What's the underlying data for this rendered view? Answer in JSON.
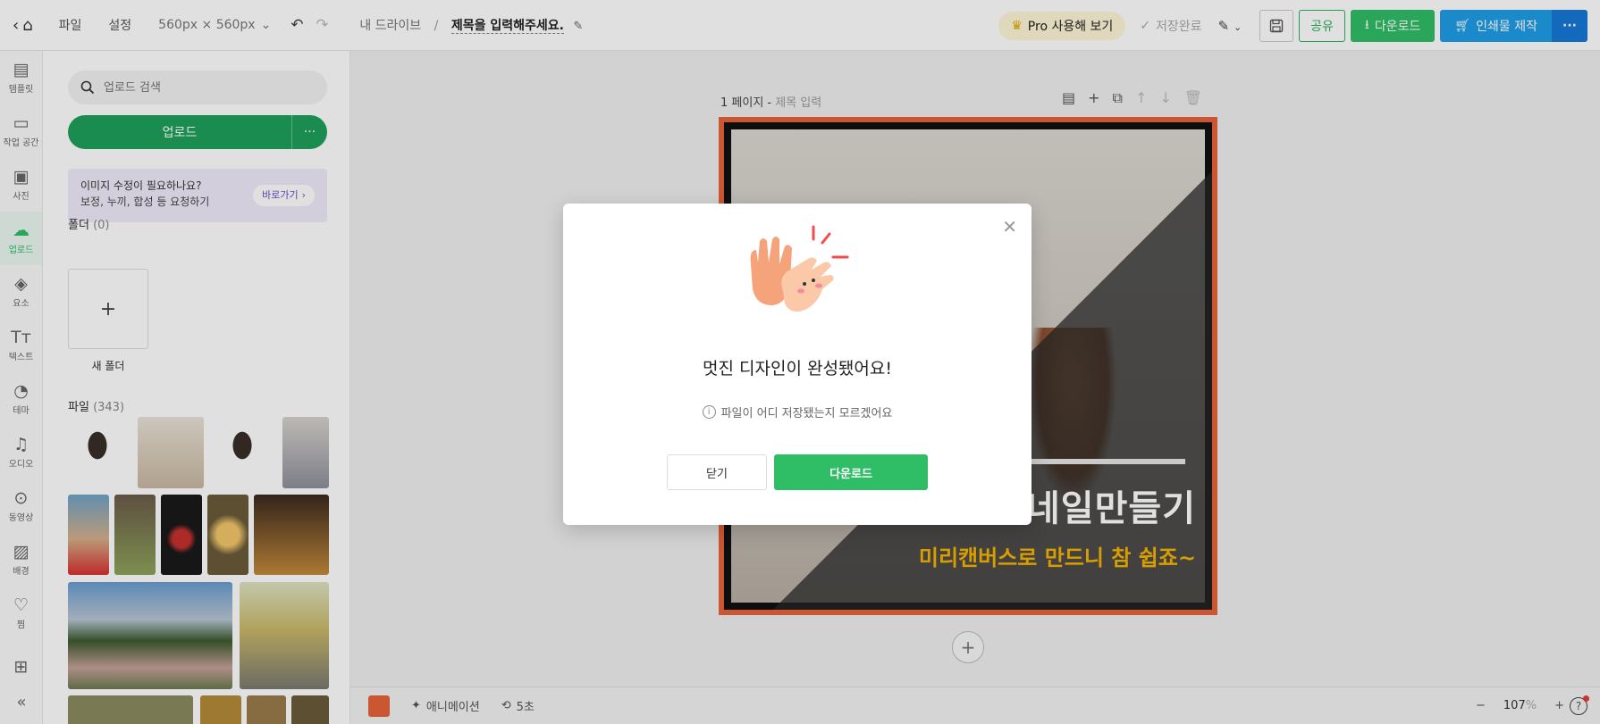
{
  "topbar": {
    "home_icon": "home-icon",
    "menu_file": "파일",
    "menu_settings": "설정",
    "canvas_size": "560px × 560px",
    "breadcrumb_drive": "내 드라이브",
    "breadcrumb_sep": "/",
    "doc_title": "제목을 입력해주세요.",
    "pro_label": "Pro 사용해 보기",
    "saved_label": "저장완료",
    "share_label": "공유",
    "download_label": "다운로드",
    "print_label": "인쇄물 제작",
    "more_label": "···"
  },
  "rail": {
    "items": [
      {
        "label": "템플릿",
        "icon": "template-icon"
      },
      {
        "label": "작업 공간",
        "icon": "workspace-icon"
      },
      {
        "label": "사진",
        "icon": "photo-icon"
      },
      {
        "label": "업로드",
        "icon": "upload-cloud-icon",
        "active": true
      },
      {
        "label": "요소",
        "icon": "elements-icon"
      },
      {
        "label": "텍스트",
        "icon": "text-icon"
      },
      {
        "label": "테마",
        "icon": "palette-icon"
      },
      {
        "label": "오디오",
        "icon": "music-icon"
      },
      {
        "label": "동영상",
        "icon": "play-icon"
      },
      {
        "label": "배경",
        "icon": "background-icon"
      },
      {
        "label": "찜",
        "icon": "heart-icon"
      },
      {
        "label": "",
        "icon": "grid-icon"
      }
    ],
    "collapse_icon": "double-chevron-left-icon"
  },
  "panel": {
    "search_placeholder": "업로드 검색",
    "upload_label": "업로드",
    "upload_more": "···",
    "promo_line1": "이미지 수정이 필요하나요?",
    "promo_line2": "보정, 누끼, 합성 등 요청하기",
    "promo_button": "바로가기",
    "folder_title": "폴더",
    "folder_count": "(0)",
    "new_folder_plus": "+",
    "new_folder_label": "새 폴더",
    "files_title": "파일",
    "files_count": "(343)"
  },
  "canvas": {
    "page_label": "1 페이지 -",
    "page_title_placeholder": "제목 입력",
    "headline": "네일만들기",
    "subheadline": "미리캔버스로 만드니 참 쉽죠~",
    "add_page": "+"
  },
  "bottombar": {
    "color_hex": "#e8643a",
    "animation_label": "애니메이션",
    "timer_label": "5초",
    "zoom_minus": "−",
    "zoom_value": "107",
    "zoom_unit": "%",
    "zoom_plus": "+",
    "help_label": "?"
  },
  "modal": {
    "close_icon": "close-icon",
    "title": "멋진 디자인이 완성됐어요!",
    "help_text": "파일이 어디 저장됐는지 모르겠어요",
    "close_button": "닫기",
    "download_button": "다운로드"
  },
  "colors": {
    "accent_green": "#2fbe66",
    "accent_blue": "#1f9ee6",
    "artboard_border": "#e8643a",
    "subheadline": "#f5b400"
  }
}
